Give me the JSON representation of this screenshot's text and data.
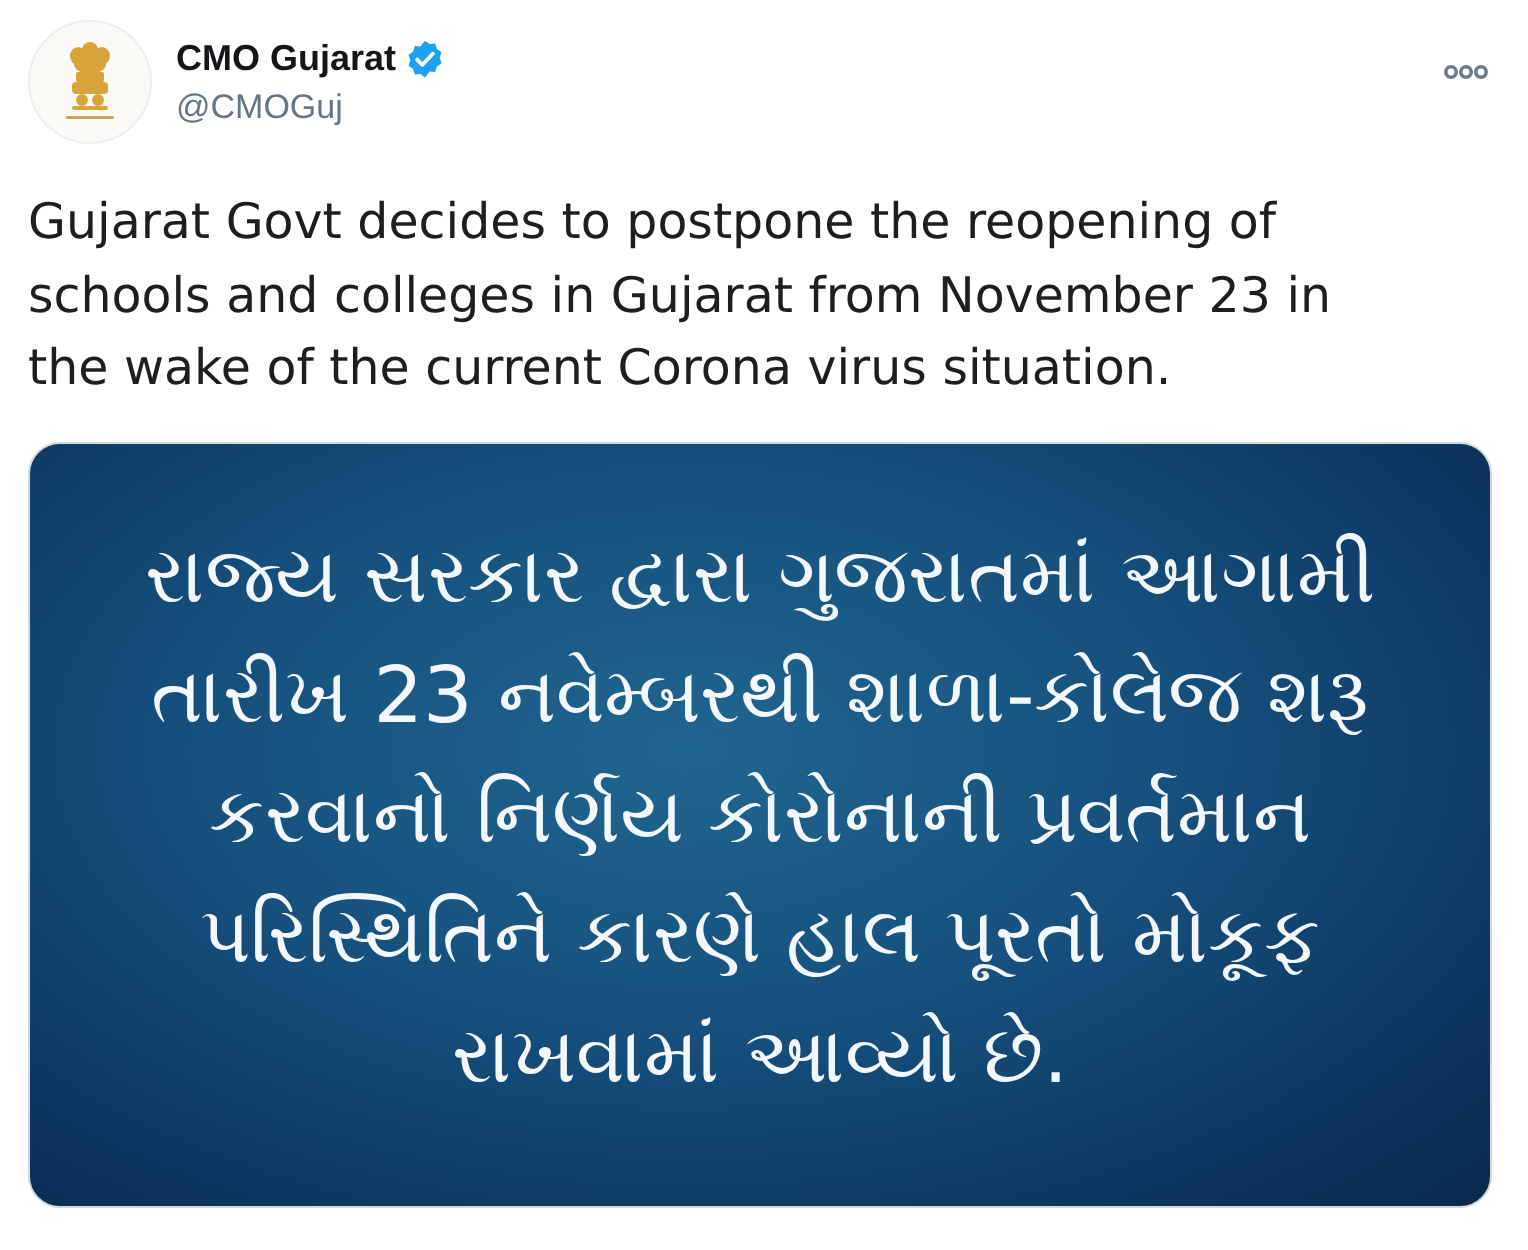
{
  "author": {
    "name": "CMO Gujarat",
    "verified": true,
    "handle": "@CMOGuj"
  },
  "tweet": {
    "lines": [
      "Gujarat Govt decides to postpone the reopening of",
      "schools and colleges in Gujarat from November 23 in",
      "the wake of the current Corona virus situation."
    ]
  },
  "media": {
    "kind": "graphic",
    "lines": [
      "રાજ્ય સરકાર દ્વારા ગુજરાતમાં આગામી",
      "તારીખ 23 નવેમ્બરથી શાળા-કોલેજ શરૂ",
      "કરવાનો નિર્ણય કોરોનાની પ્રવર્તમાન",
      "પરિસ્થિતિને કારણે હાલ પૂરતો મોકૂફ",
      "રાખવામાં આવ્યો છે."
    ]
  }
}
